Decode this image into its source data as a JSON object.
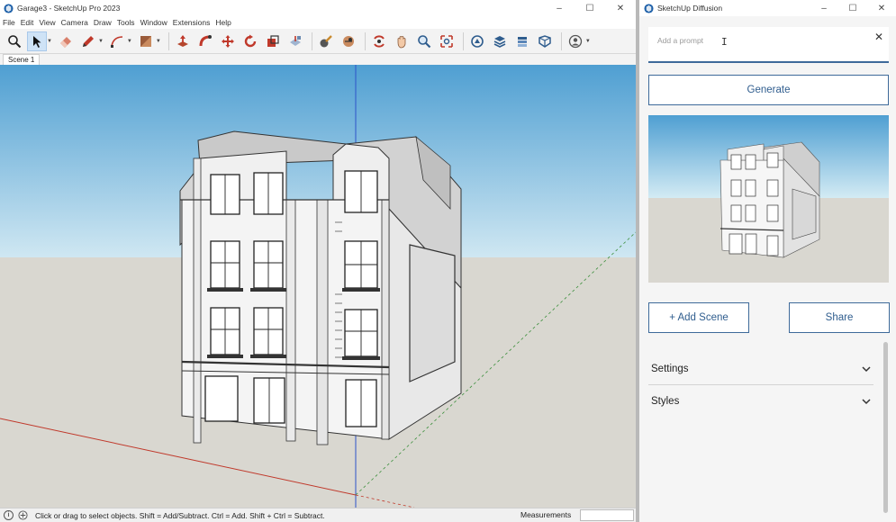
{
  "main_window": {
    "title": "Garage3 - SketchUp Pro 2023",
    "window_controls": {
      "minimize": "–",
      "maximize": "☐",
      "close": "✕"
    }
  },
  "menu": [
    "File",
    "Edit",
    "View",
    "Camera",
    "Draw",
    "Tools",
    "Window",
    "Extensions",
    "Help"
  ],
  "toolbar": {
    "tools": [
      "search-icon",
      "select-icon",
      "eraser-icon",
      "pencil-icon",
      "arc-icon",
      "paint-bucket-icon",
      "push-pull-icon",
      "follow-me-icon",
      "move-icon",
      "rotate-icon",
      "scale-icon",
      "offset-icon",
      "tape-measure-icon",
      "dimension-icon",
      "orbit-icon",
      "pan-icon",
      "zoom-icon",
      "zoom-extents-icon",
      "warehouse-icon",
      "extensions-icon",
      "layers-icon",
      "components-icon",
      "account-icon"
    ]
  },
  "scenes": {
    "tabs": [
      "Scene 1"
    ]
  },
  "status": {
    "hint": "Click or drag to select objects. Shift = Add/Subtract. Ctrl = Add. Shift + Ctrl = Subtract.",
    "measurements_label": "Measurements",
    "measurements_value": ""
  },
  "panel": {
    "title": "SketchUp Diffusion",
    "window_controls": {
      "minimize": "–",
      "maximize": "☐",
      "close": "✕"
    },
    "prompt": {
      "placeholder": "Add a prompt",
      "value": "",
      "clear": "✕"
    },
    "generate_label": "Generate",
    "add_scene_label": "+ Add Scene",
    "share_label": "Share",
    "sections": [
      "Settings",
      "Styles"
    ]
  },
  "colors": {
    "accent": "#3e6a9a",
    "sky_top": "#4f9fd2",
    "sky_bottom": "#cfe7f2",
    "ground": "#d9d7d0",
    "axis_blue": "#2d53c9",
    "axis_red": "#c0392b",
    "axis_green": "#3c8f3c"
  }
}
